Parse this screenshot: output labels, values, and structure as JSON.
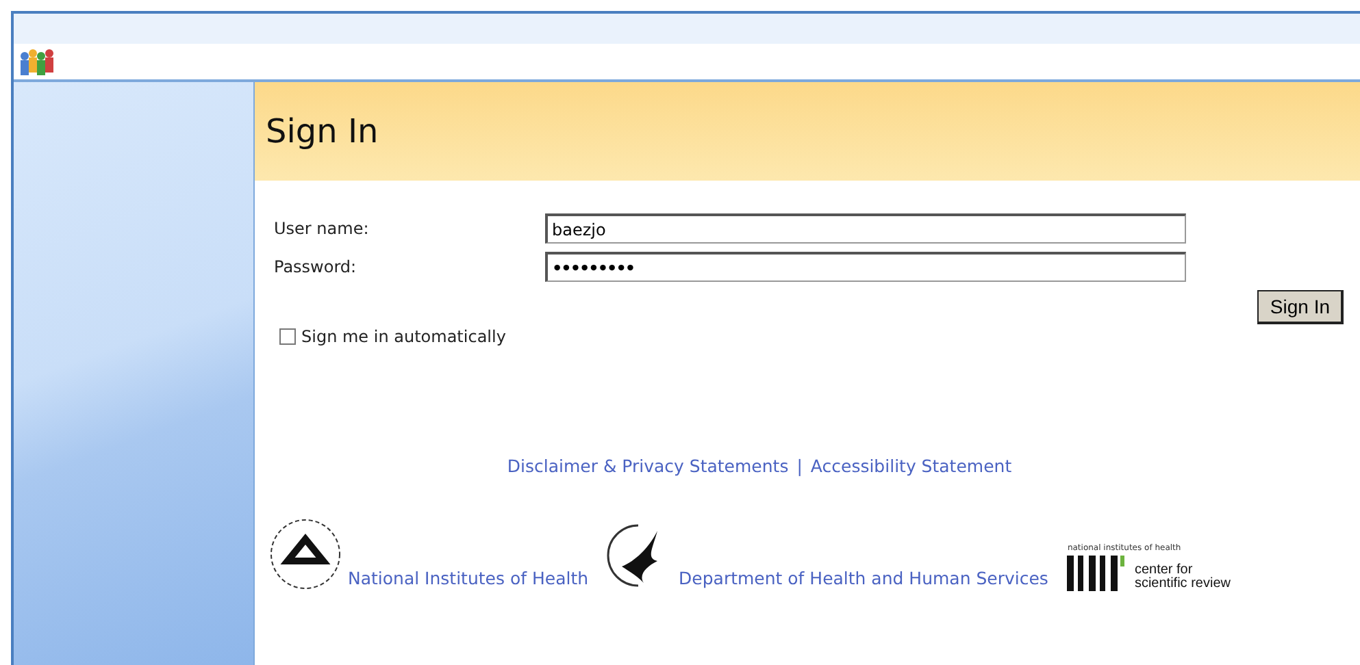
{
  "page": {
    "title": "Sign In"
  },
  "form": {
    "fields": [
      {
        "label": "User name:",
        "value": "baezjo",
        "kind": "text"
      },
      {
        "label": "Password:",
        "value": "•••••••••",
        "kind": "password"
      }
    ],
    "submit": "Sign In",
    "remember": {
      "label": "Sign me in automatically",
      "checked": false
    }
  },
  "footer_links": [
    "Disclaimer & Privacy Statements",
    "Accessibility Statement"
  ],
  "footer_separator": "|",
  "agencies": [
    {
      "name": "National Institutes of Health",
      "kind": "seal"
    },
    {
      "name": "Department of Health and Human Services",
      "kind": "eagle"
    }
  ],
  "csr_logo": {
    "top": "national institutes of health",
    "line_1": "center for",
    "line_2": "scientific review"
  }
}
